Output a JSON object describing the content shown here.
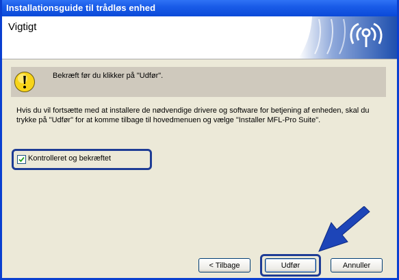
{
  "window": {
    "title": "Installationsguide til trådløs enhed"
  },
  "header": {
    "heading": "Vigtigt"
  },
  "notice": {
    "text": "Bekræft før du klikker på \"Udfør\"."
  },
  "body": {
    "text": "Hvis du vil fortsætte med at installere de nødvendige drivere og software for betjening af enheden, skal du trykke på \"Udfør\" for at komme tilbage til hovedmenuen og vælge \"Installer MFL-Pro Suite\"."
  },
  "confirm": {
    "label": "Kontrolleret og bekræftet",
    "checked": true
  },
  "buttons": {
    "back": "< Tilbage",
    "finish": "Udfør",
    "cancel": "Annuller"
  },
  "icons": {
    "notice": "warning-icon",
    "logo": "wireless-signal-icon",
    "pointer": "arrow-pointer-icon"
  },
  "colors": {
    "titlebar": "#0a49d8",
    "highlight_frame": "#1e3c95",
    "arrow": "#1d45b8"
  }
}
